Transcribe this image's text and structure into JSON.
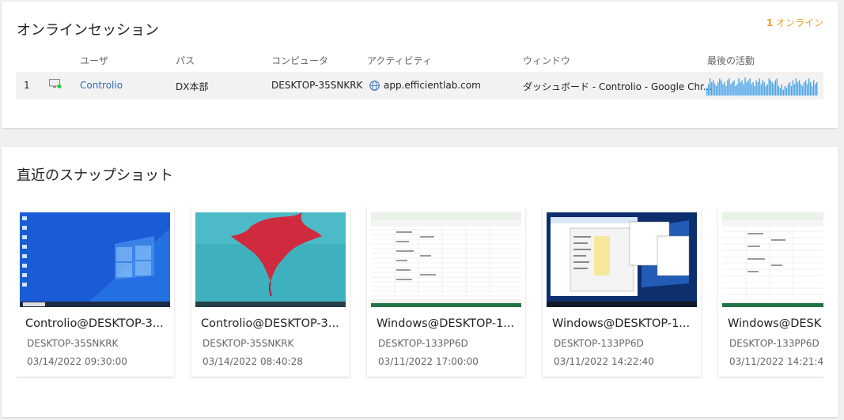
{
  "online": {
    "title": "オンラインセッション",
    "count": "1",
    "count_label": " オンライン",
    "headers": [
      "ユーザ",
      "パス",
      "コンピュータ",
      "アクティビティ",
      "ウィンドウ",
      "最後の活動"
    ],
    "rows": [
      {
        "index": "1",
        "user": "Controlio",
        "path": "DX本部",
        "computer": "DESKTOP-35SNKRK",
        "activity": "app.efficientlab.com",
        "window": "ダッシュボード - Controlio - Google Chr...",
        "status_color": "#2ecc40"
      }
    ],
    "activity_levels": [
      0.4,
      0.6,
      0.9,
      0.7,
      0.8,
      0.6,
      0.5,
      0.7,
      0.9,
      0.8,
      0.6,
      0.7,
      0.5,
      0.8,
      0.9,
      0.6,
      0.7,
      0.8,
      0.5,
      0.6,
      0.9,
      0.7,
      0.8,
      0.6,
      0.95,
      0.7,
      0.8,
      0.9,
      0.6,
      0.7,
      0.5,
      0.8,
      0.7,
      0.9,
      0.6,
      0.8,
      0.7,
      0.5,
      0.6,
      0.9,
      0.8,
      0.7,
      0.6,
      0.8,
      0.9,
      0.5,
      0.4,
      0.6,
      0.3,
      0.5,
      0.4,
      0.6,
      0.7,
      0.5,
      0.8,
      0.6,
      0.9,
      0.7,
      0.8,
      0.6,
      0.5,
      0.7,
      0.8,
      0.6,
      0.9,
      0.7,
      0.5,
      0.8,
      0.6,
      0.7
    ]
  },
  "snapshots": {
    "title": "直近のスナップショット",
    "items": [
      {
        "title": "Controlio@DESKTOP-3...",
        "host": "DESKTOP-35SNKRK",
        "time": "03/14/2022 09:30:00",
        "kind": "win-blue"
      },
      {
        "title": "Controlio@DESKTOP-3...",
        "host": "DESKTOP-35SNKRK",
        "time": "03/14/2022 08:40:28",
        "kind": "red-leaf"
      },
      {
        "title": "Windows@DESKTOP-1...",
        "host": "DESKTOP-133PP6D",
        "time": "03/11/2022 17:00:00",
        "kind": "spreadsheet"
      },
      {
        "title": "Windows@DESKTOP-1...",
        "host": "DESKTOP-133PP6D",
        "time": "03/11/2022 14:22:40",
        "kind": "windows-dialogs"
      },
      {
        "title": "Windows@DESK",
        "host": "DESKTOP-133PP6D",
        "time": "03/11/2022 14:21:4",
        "kind": "spreadsheet"
      }
    ]
  },
  "colors": {
    "accent_orange": "#f0a020",
    "link_blue": "#2a6db5",
    "spark_blue": "#4aa3e8"
  }
}
